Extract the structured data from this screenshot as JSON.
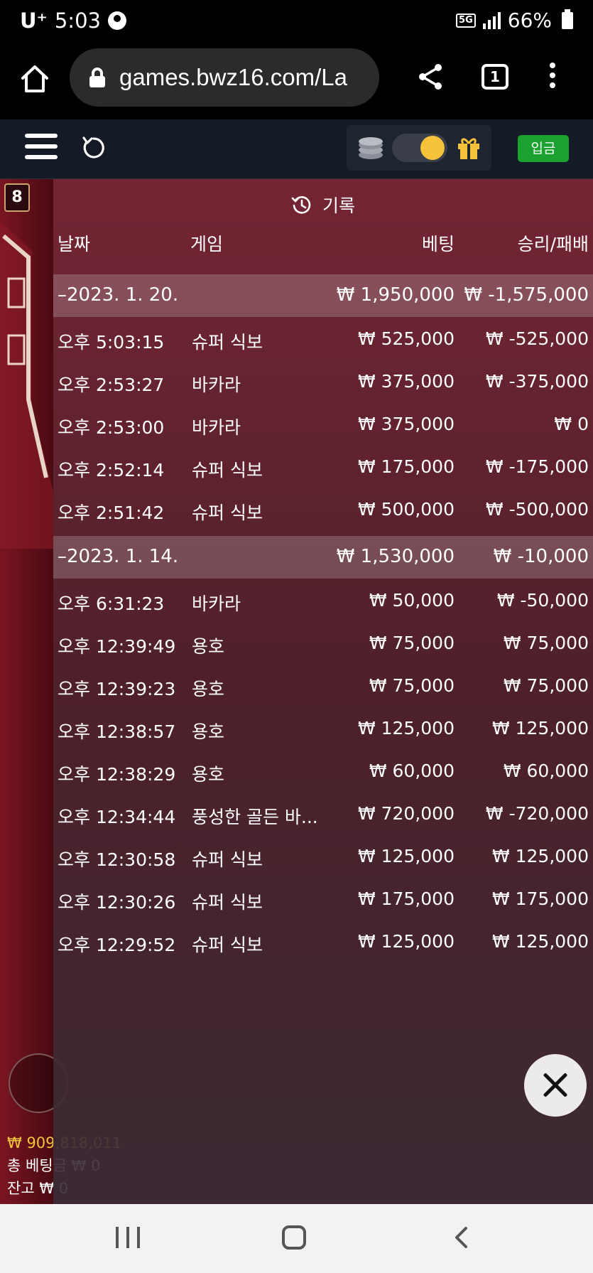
{
  "status": {
    "carrier": "U⁺",
    "time": "5:03",
    "network": "5G",
    "battery": "66%"
  },
  "browser": {
    "url": "games.bwz16.com/La",
    "tab_count": "1"
  },
  "header": {
    "deposit_label": "입금"
  },
  "game": {
    "limit_badge": "8",
    "balance": "₩ 909,818,011",
    "total_bet": "총 베팅금 ₩ 0",
    "remaining": "잔고 ₩ 0"
  },
  "history": {
    "title": "기록",
    "headers": {
      "date": "날짜",
      "game": "게임",
      "bet": "베팅",
      "result": "승리/패배"
    },
    "groups": [
      {
        "date": "–2023. 1. 20.",
        "bet_total": "₩ 1,950,000",
        "result_total": "₩ -1,575,000",
        "rows": [
          {
            "time": "오후 5:03:15",
            "game": "슈퍼 식보",
            "bet": "₩ 525,000",
            "result": "₩ -525,000"
          },
          {
            "time": "오후 2:53:27",
            "game": "바카라",
            "bet": "₩ 375,000",
            "result": "₩ -375,000"
          },
          {
            "time": "오후 2:53:00",
            "game": "바카라",
            "bet": "₩ 375,000",
            "result": "₩ 0"
          },
          {
            "time": "오후 2:52:14",
            "game": "슈퍼 식보",
            "bet": "₩ 175,000",
            "result": "₩ -175,000"
          },
          {
            "time": "오후 2:51:42",
            "game": "슈퍼 식보",
            "bet": "₩ 500,000",
            "result": "₩ -500,000"
          }
        ]
      },
      {
        "date": "–2023. 1. 14.",
        "bet_total": "₩ 1,530,000",
        "result_total": "₩ -10,000",
        "rows": [
          {
            "time": "오후 6:31:23",
            "game": "바카라",
            "bet": "₩ 50,000",
            "result": "₩ -50,000"
          },
          {
            "time": "오후 12:39:49",
            "game": "용호",
            "bet": "₩ 75,000",
            "result": "₩ 75,000"
          },
          {
            "time": "오후 12:39:23",
            "game": "용호",
            "bet": "₩ 75,000",
            "result": "₩ 75,000"
          },
          {
            "time": "오후 12:38:57",
            "game": "용호",
            "bet": "₩ 125,000",
            "result": "₩ 125,000"
          },
          {
            "time": "오후 12:38:29",
            "game": "용호",
            "bet": "₩ 60,000",
            "result": "₩ 60,000"
          },
          {
            "time": "오후 12:34:44",
            "game": "풍성한 골든 바...",
            "bet": "₩ 720,000",
            "result": "₩ -720,000"
          },
          {
            "time": "오후 12:30:58",
            "game": "슈퍼 식보",
            "bet": "₩ 125,000",
            "result": "₩ 125,000"
          },
          {
            "time": "오후 12:30:26",
            "game": "슈퍼 식보",
            "bet": "₩ 175,000",
            "result": "₩ 175,000"
          },
          {
            "time": "오후 12:29:52",
            "game": "슈퍼 식보",
            "bet": "₩ 125,000",
            "result": "₩ 125,000"
          }
        ]
      }
    ]
  }
}
